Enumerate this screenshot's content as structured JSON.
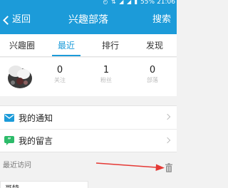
{
  "status_bar": {
    "signal_icons": "◴ ⇅ ◢ ◢ ▮",
    "battery": "55%",
    "time": "21:06"
  },
  "appbar": {
    "back_label": "返回",
    "title": "兴趣部落",
    "search_label": "搜索"
  },
  "tabs": [
    {
      "label": "兴趣圈",
      "active": false
    },
    {
      "label": "最近",
      "active": true
    },
    {
      "label": "排行",
      "active": false
    },
    {
      "label": "发现",
      "active": false
    }
  ],
  "profile": {
    "stats": [
      {
        "value": "0",
        "label": "关注"
      },
      {
        "value": "1",
        "label": "粉丝"
      },
      {
        "value": "0",
        "label": "部落"
      }
    ]
  },
  "menu": [
    {
      "label": "我的通知",
      "icon": "mail-icon"
    },
    {
      "label": "我的留言",
      "icon": "quote-message-icon"
    }
  ],
  "recent": {
    "header": "最近访问",
    "items": [
      "哥特"
    ]
  },
  "colors": {
    "primary": "#1c9bd9",
    "background": "#f2f2f2",
    "annotation": "#e53935",
    "message_green": "#2dbb6a"
  }
}
